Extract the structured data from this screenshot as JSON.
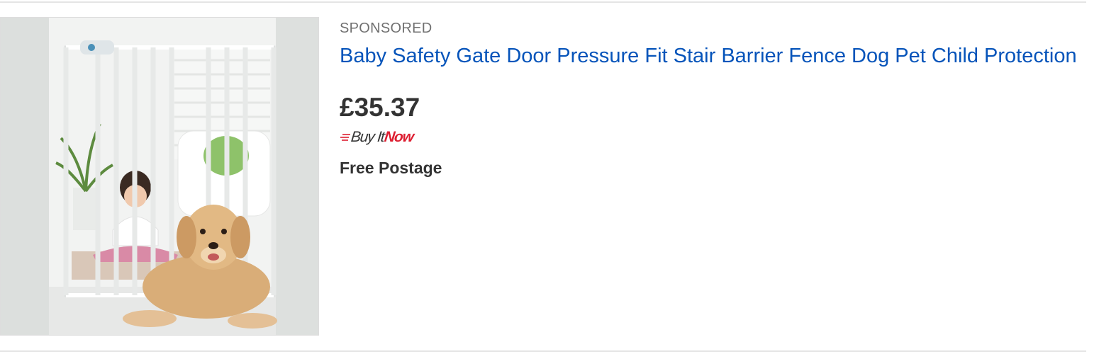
{
  "listing": {
    "sponsored_label": "SPONSORED",
    "title": "Baby Safety Gate Door Pressure Fit Stair Barrier Fence Dog Pet Child Protection",
    "price": "£35.37",
    "buy_it_now": {
      "buy": "Buy It",
      "now": "Now"
    },
    "postage": "Free Postage",
    "image_alt": "Baby Safety Gate Door Pressure Fit Stair Barrier Fence Dog Pet Child Protection"
  },
  "colors": {
    "title_link": "#0654ba",
    "price": "#333333",
    "sponsored": "#707070",
    "buy_it_now_red": "#dd1e31",
    "divider": "#e5e5e5"
  }
}
